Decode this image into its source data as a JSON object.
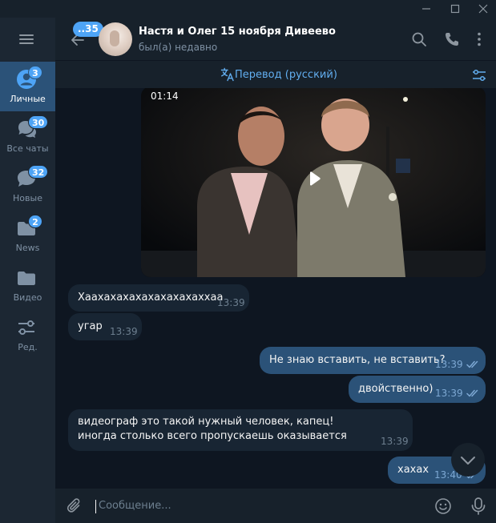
{
  "sidebar": {
    "folders": [
      {
        "label": "Личные",
        "badge": "3",
        "icon": "person-circle-icon"
      },
      {
        "label": "Все чаты",
        "badge": "30",
        "icon": "chats-icon"
      },
      {
        "label": "Новые",
        "badge": "32",
        "icon": "chat-bubble-icon"
      },
      {
        "label": "News",
        "badge": "2",
        "icon": "folder-icon"
      },
      {
        "label": "Видео",
        "badge": "",
        "icon": "folder-icon"
      },
      {
        "label": "Ред.",
        "badge": "",
        "icon": "edit-filters-icon"
      }
    ]
  },
  "header": {
    "back_badge": "..35",
    "title": "Настя и Олег 15 ноября Дивеево",
    "status": "был(а) недавно"
  },
  "translate_bar": {
    "label": "Перевод (русский)"
  },
  "video": {
    "duration": "01:14"
  },
  "messages": [
    {
      "direction": "in",
      "text": "Хаахахахахахахахахаххаа",
      "time": "13:39"
    },
    {
      "direction": "in",
      "text": "угар",
      "time": "13:39"
    },
    {
      "direction": "out",
      "text": "Не знаю вставить, не вставить?",
      "time": "13:39",
      "read": true
    },
    {
      "direction": "out",
      "text": "двойственно)",
      "time": "13:39",
      "read": true
    },
    {
      "direction": "in",
      "text": "видеограф это такой нужный человек, капец! иногда столько всего пропускаешь оказывается",
      "time": "13:39"
    },
    {
      "direction": "out",
      "text": "хахах",
      "time": "13:40",
      "read": true
    }
  ],
  "composer": {
    "placeholder": "Сообщение..."
  },
  "colors": {
    "accent": "#4ea4f6",
    "outgoing_bubble": "#2b5278",
    "incoming_bubble": "#182533",
    "chat_background": "#0e1621"
  }
}
